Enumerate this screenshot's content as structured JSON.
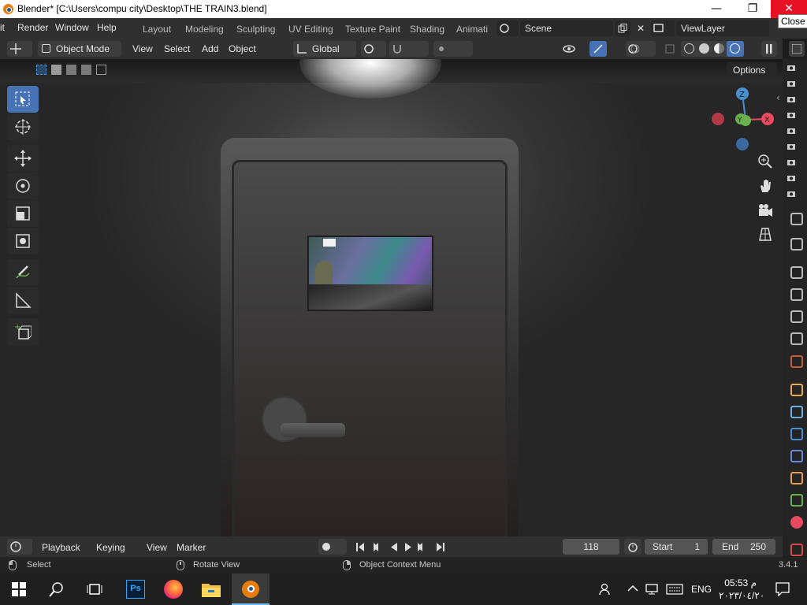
{
  "window": {
    "title": "Blender* [C:\\Users\\compu city\\Desktop\\THE TRAIN3.blend]",
    "minimize": "—",
    "maximize": "❐",
    "close": "✕",
    "close_tooltip": "Close"
  },
  "topbar": {
    "menus": [
      "it",
      "Render",
      "Window",
      "Help"
    ],
    "workspaces": [
      "Layout",
      "Modeling",
      "Sculpting",
      "UV Editing",
      "Texture Paint",
      "Shading",
      "Animati"
    ],
    "scene": "Scene",
    "view_layer": "ViewLayer"
  },
  "header": {
    "mode": "Object Mode",
    "menus": [
      "View",
      "Select",
      "Add",
      "Object"
    ],
    "orientation": "Global",
    "options": "Options"
  },
  "viewport": {
    "gizmo": {
      "z": "Z",
      "y": "Y",
      "x": "X"
    },
    "colors": {
      "x_axis": "#e84a5f",
      "y_axis": "#6ab04c",
      "z_axis": "#4a8fd0",
      "active_tool": "#4772b3"
    }
  },
  "timeline": {
    "menus": [
      "Playback",
      "Keying",
      "View",
      "Marker"
    ],
    "current_frame": "118",
    "start_label": "Start",
    "start_value": "1",
    "end_label": "End",
    "end_value": "250"
  },
  "statusbar": {
    "select": "Select",
    "rotate": "Rotate View",
    "context": "Object Context Menu",
    "version": "3.4.1"
  },
  "taskbar": {
    "lang": "ENG",
    "time": "05:53 م",
    "date": "٢٠٢٣/٠٤/٢٠"
  }
}
